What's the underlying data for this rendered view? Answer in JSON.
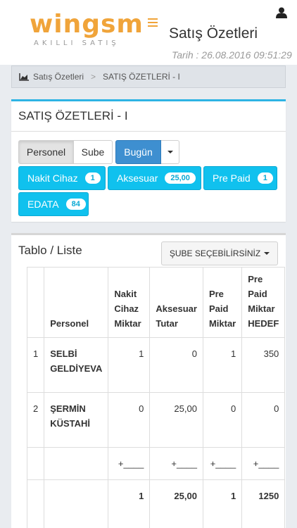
{
  "header": {
    "logo_text": "wingsm",
    "logo_subtext": "AKILLI SATIŞ",
    "page_title": "Satış Özetleri",
    "timestamp": "Tarih : 26.08.2016 09:51:29",
    "accent_color": "#f0a43a"
  },
  "breadcrumb": {
    "items": [
      "Satış Özetleri",
      "SATIŞ ÖZETLERİ - I"
    ],
    "separator": ">"
  },
  "summary_box": {
    "title": "SATIŞ ÖZETLERİ - I",
    "group_toggle": [
      "Personel",
      "Sube"
    ],
    "selected_group": "Personel",
    "period_label": "Bugün",
    "tiles": [
      {
        "label": "Nakit Cihaz",
        "count": "1"
      },
      {
        "label": "Aksesuar",
        "count": "25,00"
      },
      {
        "label": "Pre Paid",
        "count": "1"
      },
      {
        "label": "EDATA",
        "count": "84"
      }
    ],
    "tile_color": "#10c1ee"
  },
  "table_box": {
    "title": "Tablo / Liste",
    "branch_dropdown": "ŞUBE SEÇEBİLİRSİNİZ",
    "columns": [
      "",
      "Personel",
      "Nakit Cihaz Miktar",
      "Aksesuar Tutar",
      "Pre Paid Miktar",
      "Pre Paid Miktar HEDEF"
    ],
    "rows": [
      [
        "1",
        "SELBİ GELDİYEVA",
        "1",
        "0",
        "1",
        "350"
      ],
      [
        "2",
        "ŞERMİN KÜSTAHİ",
        "0",
        "25,00",
        "0",
        "0"
      ]
    ],
    "sum_row": [
      "",
      "",
      "+____",
      "+____",
      "+____",
      "+____"
    ],
    "total_row": [
      "",
      "",
      "1",
      "25,00",
      "1",
      "1250"
    ]
  }
}
